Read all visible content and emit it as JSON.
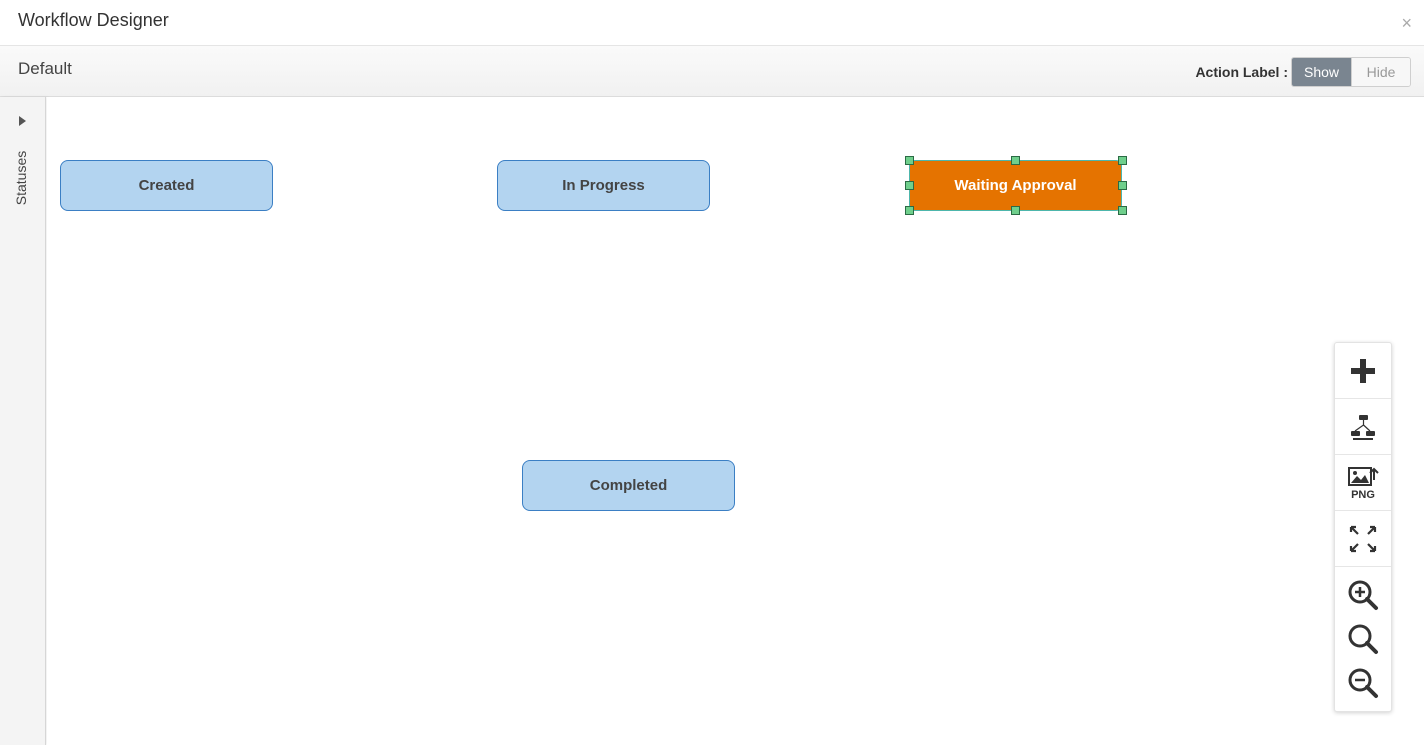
{
  "window": {
    "title": "Workflow Designer",
    "close": "×"
  },
  "toolbar": {
    "workflow_name": "Default",
    "action_label": "Action Label :",
    "show": "Show",
    "hide": "Hide",
    "active": "show"
  },
  "side_panel": {
    "label": "Statuses"
  },
  "nodes": [
    {
      "label": "Created"
    },
    {
      "label": "In Progress"
    },
    {
      "label": "Waiting Approval",
      "selected": true
    },
    {
      "label": "Completed"
    }
  ],
  "tools": {
    "add": "plus-icon",
    "auto_layout": "auto-layout-icon",
    "export": "export-png-icon",
    "export_text": "PNG",
    "fit": "fit-screen-icon",
    "zoom_in": "zoom-in-icon",
    "zoom_reset": "zoom-reset-icon",
    "zoom_out": "zoom-out-icon"
  },
  "colors": {
    "node_fill": "#b3d4f0",
    "node_border": "#3b7fc4",
    "selected_fill": "#e57300",
    "handle": "#6fcf8c"
  }
}
